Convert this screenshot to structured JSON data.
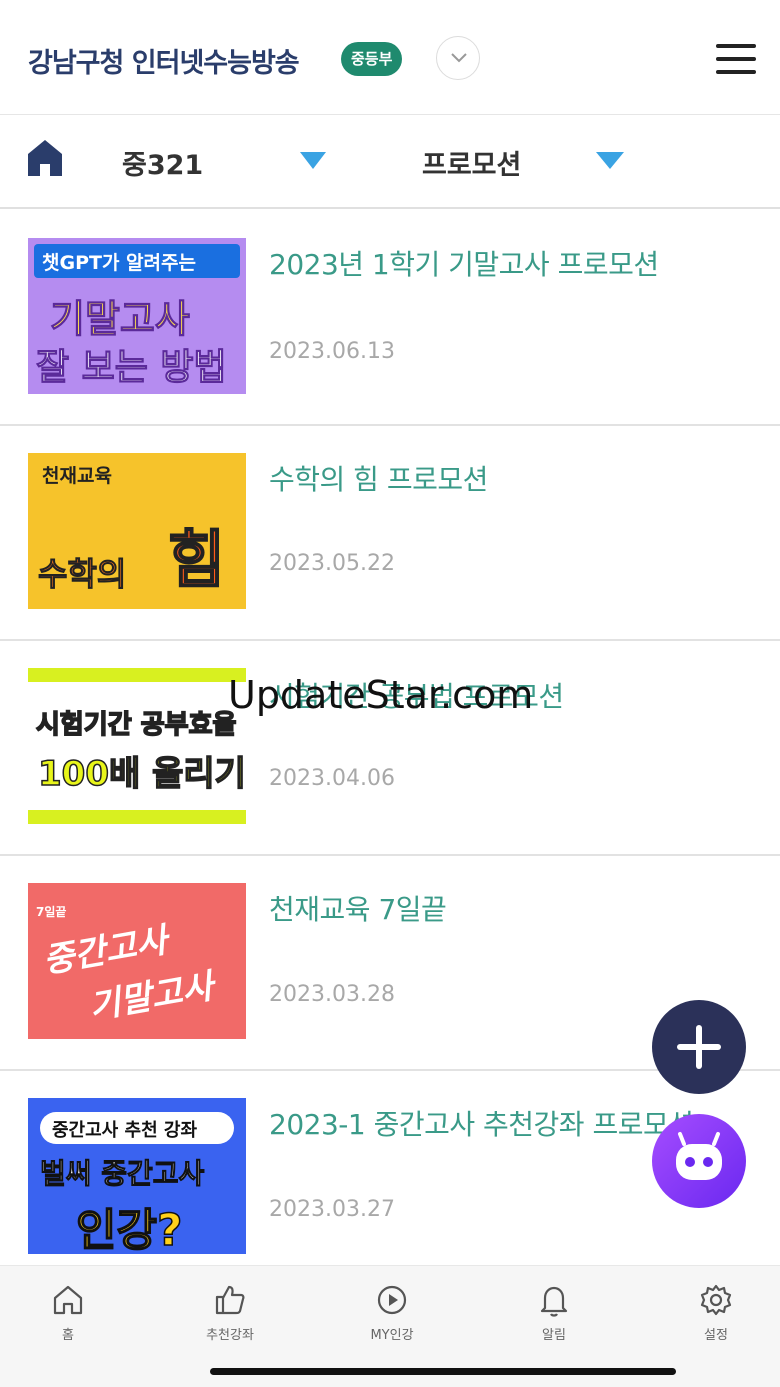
{
  "header": {
    "title": "강남구청 인터넷수능방송",
    "badge": "중등부"
  },
  "filters": {
    "grade": "중321",
    "category": "프로모션"
  },
  "items": [
    {
      "title": "2023년 1학기 기말고사 프로모션",
      "date": "2023.06.13",
      "thumb_lines": [
        "챗GPT가 알려주는",
        "기말고사",
        "잘 보는 방법"
      ]
    },
    {
      "title": "수학의 힘 프로모션",
      "date": "2023.05.22",
      "thumb_lines": [
        "천재교육",
        "수학의",
        "힘"
      ]
    },
    {
      "title": "시험기간 공부법 프로모션",
      "date": "2023.04.06",
      "thumb_lines": [
        "시험기간 공부효율",
        "100배 올리기"
      ]
    },
    {
      "title": "천재교육 7일끝",
      "date": "2023.03.28",
      "thumb_lines": [
        "7일끝",
        "중간고사",
        "기말고사"
      ]
    },
    {
      "title": "2023-1 중간고사 추천강좌 프로모션",
      "date": "2023.03.27",
      "thumb_lines": [
        "중간고사 추천 강좌",
        "벌써 중간고사",
        "인강?"
      ]
    }
  ],
  "watermark": "UpdateStar.com",
  "nav": {
    "home": "홈",
    "recommend": "추천강좌",
    "my": "MY인강",
    "alarm": "알림",
    "settings": "설정"
  }
}
